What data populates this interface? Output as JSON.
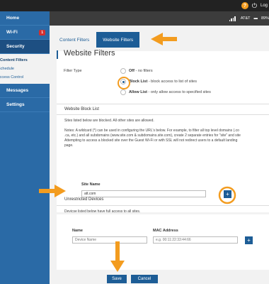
{
  "header": {
    "help_icon": "help-icon",
    "power_icon": "power-icon",
    "logout_label": "Log",
    "carrier": "AT&T",
    "battery": "89%"
  },
  "sidebar": {
    "items": [
      {
        "label": "Home",
        "badge": ""
      },
      {
        "label": "Wi-Fi",
        "badge": "1"
      },
      {
        "label": "Security",
        "badge": ""
      }
    ],
    "subitems": [
      "Content Filters",
      "Schedule",
      "Access Control"
    ],
    "items_after": [
      "Messages",
      "Settings"
    ]
  },
  "tabs": [
    "Content Filters",
    "Website Filters"
  ],
  "page": {
    "title": "Website Filters",
    "filter_type_label": "Filter Type",
    "options": [
      {
        "name": "Off",
        "desc": " - no filters"
      },
      {
        "name": "Block List",
        "desc": " - block access to list of sites"
      },
      {
        "name": "Allow List",
        "desc": " - only allow access to specified sites"
      }
    ]
  },
  "block_list": {
    "title": "Website Block List",
    "intro": "Sites listed below are blocked. All other sites are allowed.",
    "note_lines": [
      "Notes: A wildcard (*) can be used in configuring the URL's below. For example, to filter all top level domains (.co",
      ".ca, etc.) and all subdomains (www.site.com & subdomains.site.com), create 2 separate entries for \"site\" and site",
      "Attempting to access a blocked site over the Guest Wi-Fi or with SSL will not redirect users to a default landing",
      "page."
    ],
    "site_name_label": "Site Name",
    "site_name_value": "att.com"
  },
  "unrestricted": {
    "title": "Unrestricted Devices",
    "intro": "Devicse listed below have full access to all sites.",
    "name_label": "Name",
    "name_placeholder": "Device Name",
    "mac_label": "MAC Address",
    "mac_placeholder": "e.g. 00:11:22:33:44:66"
  },
  "actions": {
    "save": "Save",
    "cancel": "Cancel"
  },
  "colors": {
    "accent": "#1d5d96",
    "sidebar": "#2a6aa6",
    "highlight": "#f39c1f"
  }
}
